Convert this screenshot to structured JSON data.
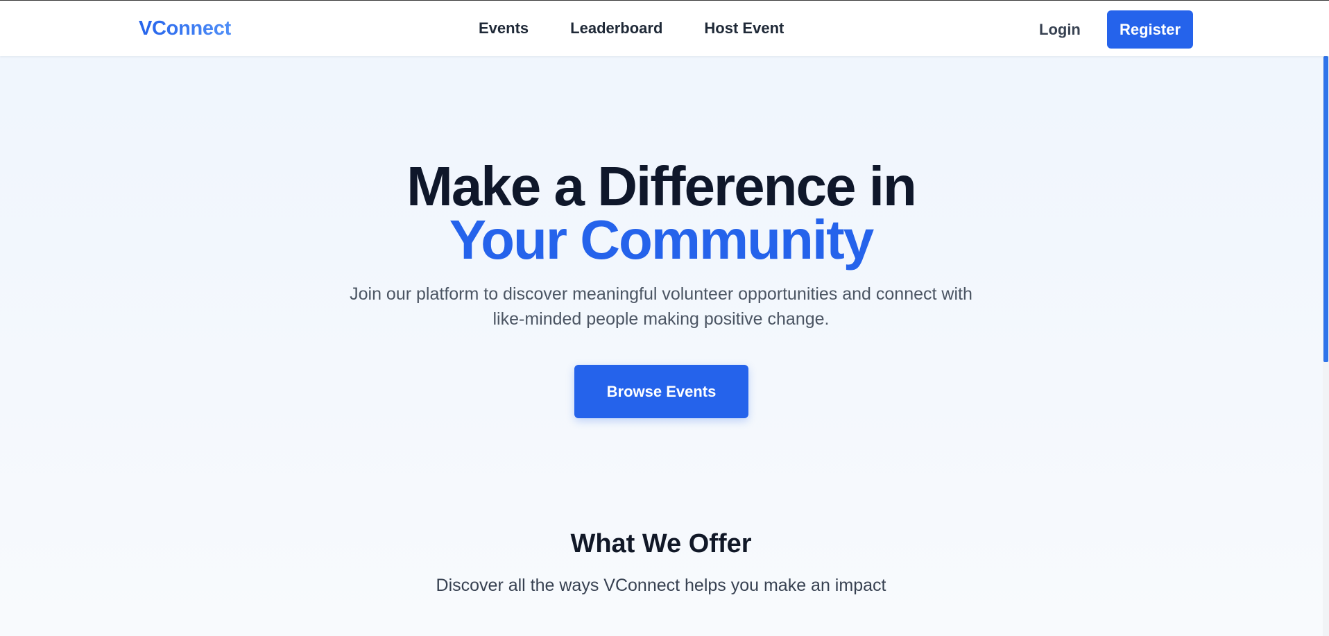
{
  "nav": {
    "brand": "VConnect",
    "links": [
      "Events",
      "Leaderboard",
      "Host Event"
    ],
    "login": "Login",
    "register": "Register"
  },
  "hero": {
    "title_line1": "Make a Difference in",
    "title_line2": "Your Community",
    "subtitle": "Join our platform to discover meaningful volunteer opportunities and connect with like-minded people making positive change.",
    "cta": "Browse Events"
  },
  "offer": {
    "title": "What We Offer",
    "subtitle": "Discover all the ways VConnect helps you make an impact"
  },
  "colors": {
    "accent": "#2563eb",
    "heading": "#0f172a",
    "background": "#eff5fd"
  }
}
